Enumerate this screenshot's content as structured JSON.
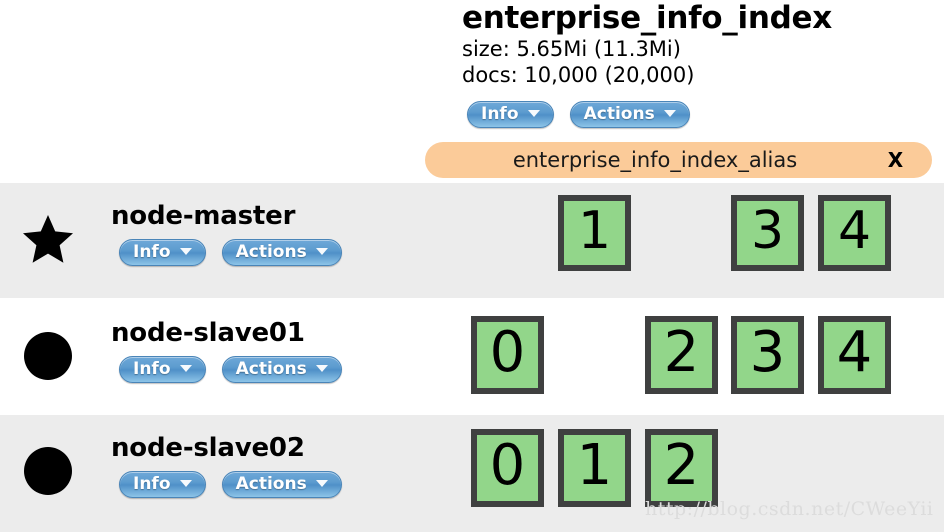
{
  "index": {
    "name": "enterprise_info_index",
    "size_line": "size: 5.65Mi (11.3Mi)",
    "docs_line": "docs: 10,000 (20,000)",
    "info_label": "Info",
    "actions_label": "Actions",
    "alias": {
      "name": "enterprise_info_index_alias",
      "close_label": "X"
    }
  },
  "colors": {
    "row_shade": "#ececec",
    "row_plain": "#ffffff",
    "shard_fill": "#92d68a",
    "shard_border": "#3f4040",
    "alias_bg": "#fbcb99",
    "button_blue": "#5d9ccf",
    "watermark": "#dcdcdc"
  },
  "nodes": [
    {
      "name": "node-master",
      "icon": "star-icon",
      "role": "master",
      "row_background": "shade",
      "info_label": "Info",
      "actions_label": "Actions",
      "shards": [
        {
          "column": 1,
          "label": "1",
          "state": "assigned"
        },
        {
          "column": 3,
          "label": "3",
          "state": "assigned"
        },
        {
          "column": 4,
          "label": "4",
          "state": "assigned"
        }
      ]
    },
    {
      "name": "node-slave01",
      "icon": "circle-icon",
      "role": "data",
      "row_background": "plain",
      "info_label": "Info",
      "actions_label": "Actions",
      "shards": [
        {
          "column": 0,
          "label": "0",
          "state": "assigned"
        },
        {
          "column": 2,
          "label": "2",
          "state": "assigned"
        },
        {
          "column": 3,
          "label": "3",
          "state": "assigned"
        },
        {
          "column": 4,
          "label": "4",
          "state": "assigned"
        }
      ]
    },
    {
      "name": "node-slave02",
      "icon": "circle-icon",
      "role": "data",
      "row_background": "shade",
      "info_label": "Info",
      "actions_label": "Actions",
      "shards": [
        {
          "column": 0,
          "label": "0",
          "state": "assigned"
        },
        {
          "column": 1,
          "label": "1",
          "state": "assigned"
        },
        {
          "column": 2,
          "label": "2",
          "state": "assigned"
        }
      ]
    }
  ],
  "shard_columns": {
    "count": 5,
    "left_positions": [
      471,
      558,
      645,
      731,
      818
    ],
    "width": 73
  },
  "watermark": "http://blog.csdn.net/CWeeYii"
}
